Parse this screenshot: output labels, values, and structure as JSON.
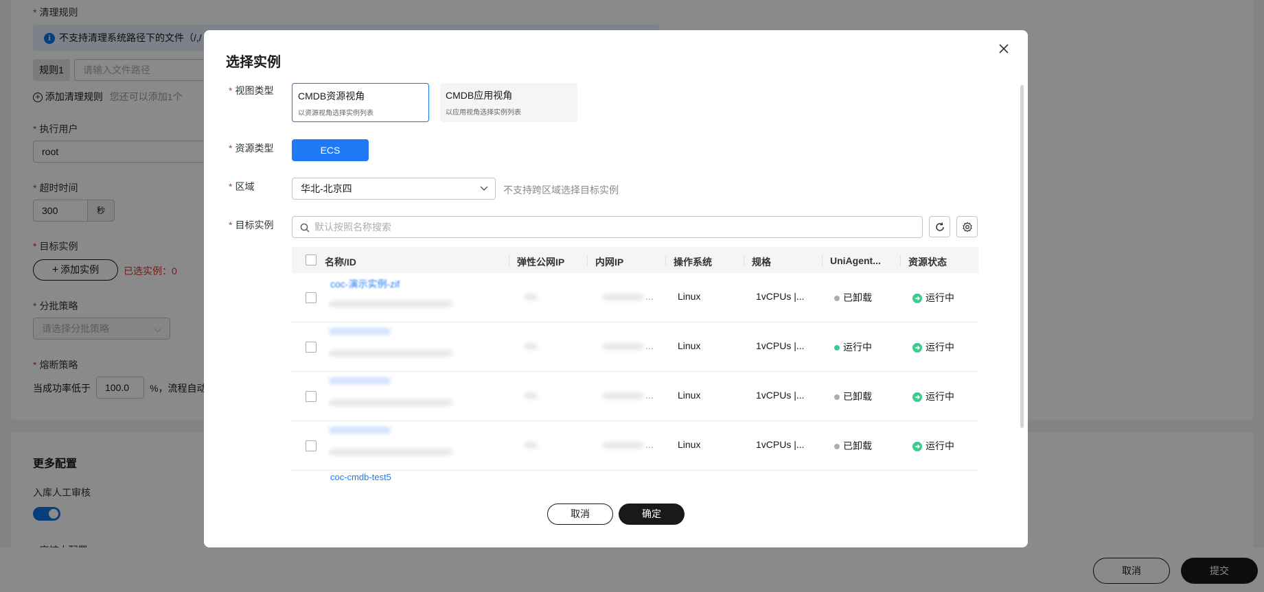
{
  "page": {
    "clean_rule": {
      "label": "清理规则",
      "notice": "不支持清理系统路径下的文件（/,/",
      "rule_tag": "规则1",
      "path_placeholder": "请输入文件路径",
      "add_label": "添加清理规则",
      "add_hint": "您还可以添加1个"
    },
    "exec_user": {
      "label": "执行用户",
      "value": "root"
    },
    "timeout": {
      "label": "超时时间",
      "value": "300",
      "unit": "秒"
    },
    "target": {
      "label": "目标实例",
      "add_button": "添加实例",
      "selected": "已选实例：0"
    },
    "batch": {
      "label": "分批策略",
      "placeholder": "请选择分批策略"
    },
    "fuse": {
      "label": "熔断策略",
      "prefix": "当成功率低于",
      "value": "100.0",
      "suffix": "%，流程自动"
    },
    "more": {
      "title": "更多配置",
      "review_label": "入库人工审核",
      "review_on": true,
      "next_label": "审核人配置"
    },
    "footer": {
      "cancel": "取消",
      "submit": "提交"
    }
  },
  "modal": {
    "title": "选择实例",
    "view_type": {
      "label": "视图类型",
      "options": [
        {
          "title": "CMDB资源视角",
          "desc": "以资源视角选择实例列表",
          "selected": true
        },
        {
          "title": "CMDB应用视角",
          "desc": "以应用视角选择实例列表",
          "selected": false
        }
      ]
    },
    "resource_type": {
      "label": "资源类型",
      "value": "ECS"
    },
    "region": {
      "label": "区域",
      "value": "华北-北京四",
      "hint": "不支持跨区域选择目标实例"
    },
    "target": {
      "label": "目标实例",
      "search_placeholder": "默认按照名称搜索"
    },
    "table": {
      "columns": [
        "名称/ID",
        "弹性公网IP",
        "内网IP",
        "操作系统",
        "规格",
        "UniAgent...",
        "资源状态"
      ],
      "rows": [
        {
          "name": "coc-演示实例-zif",
          "os": "Linux",
          "spec": "1vCPUs |...",
          "agent": "已卸载",
          "agent_color": "#adadad",
          "status": "运行中"
        },
        {
          "name": "",
          "os": "Linux",
          "spec": "1vCPUs |...",
          "agent": "运行中",
          "agent_color": "#3dcb8f",
          "status": "运行中"
        },
        {
          "name": "",
          "os": "Linux",
          "spec": "1vCPUs |...",
          "agent": "已卸载",
          "agent_color": "#adadad",
          "status": "运行中"
        },
        {
          "name": "",
          "os": "Linux",
          "spec": "1vCPUs |...",
          "agent": "已卸载",
          "agent_color": "#adadad",
          "status": "运行中"
        }
      ],
      "partial_row_name": "coc-cmdb-test5"
    },
    "cancel": "取消",
    "confirm": "确定"
  }
}
